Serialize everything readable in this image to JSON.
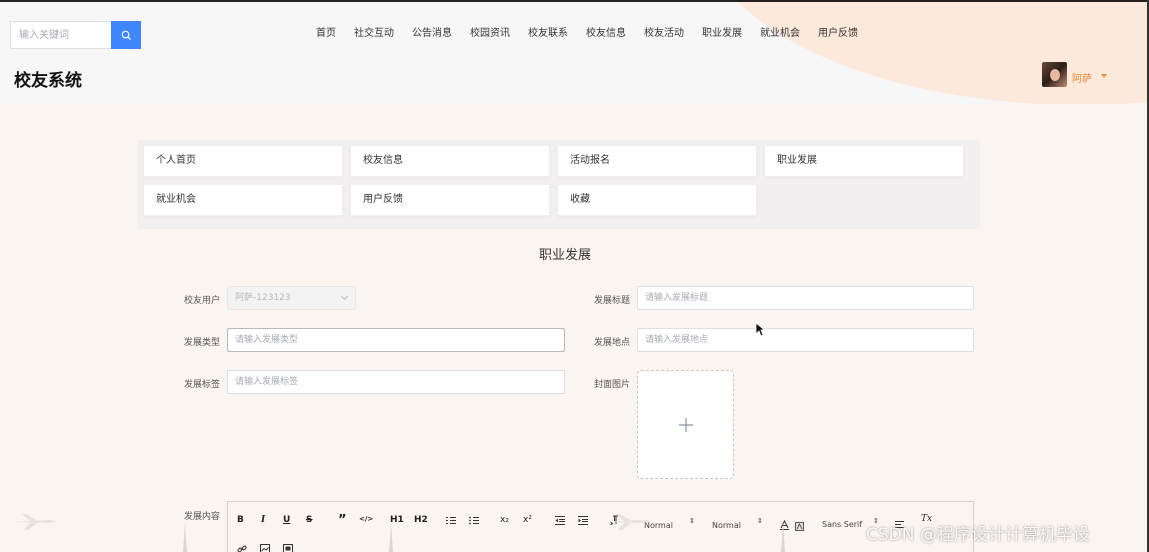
{
  "search": {
    "placeholder": "输入关键词"
  },
  "nav": {
    "items": [
      "首页",
      "社交互动",
      "公告消息",
      "校园资讯",
      "校友联系",
      "校友信息",
      "校友活动",
      "职业发展",
      "就业机会",
      "用户反馈"
    ]
  },
  "site_title": "校友系统",
  "user": {
    "name": "阿萨"
  },
  "menu": {
    "items": [
      "个人首页",
      "校友信息",
      "活动报名",
      "职业发展",
      "就业机会",
      "用户反馈",
      "收藏"
    ]
  },
  "page_title": "职业发展",
  "form": {
    "user_label": "校友用户",
    "user_value": "阿萨-123123",
    "title_label": "发展标题",
    "title_placeholder": "请输入发展标题",
    "type_label": "发展类型",
    "type_placeholder": "请输入发展类型",
    "location_label": "发展地点",
    "location_placeholder": "请输入发展地点",
    "tag_label": "发展标签",
    "tag_placeholder": "请输入发展标签",
    "cover_label": "封面图片",
    "content_label": "发展内容"
  },
  "editor_toolbar": {
    "bold": "B",
    "italic": "I",
    "underline": "U",
    "strike": "S",
    "quote": "”",
    "code": "</>",
    "h1": "H1",
    "h2": "H2",
    "sub": "x₂",
    "sup": "x²",
    "size_value": "Normal",
    "header_value": "Normal",
    "font_value": "Sans Serif",
    "clean": "Tx"
  },
  "watermark": "CSDN @程序设计计算机毕设",
  "colors": {
    "accent": "#3f86ff",
    "user_name": "#f08a3c",
    "background": "#fbf5f1"
  }
}
